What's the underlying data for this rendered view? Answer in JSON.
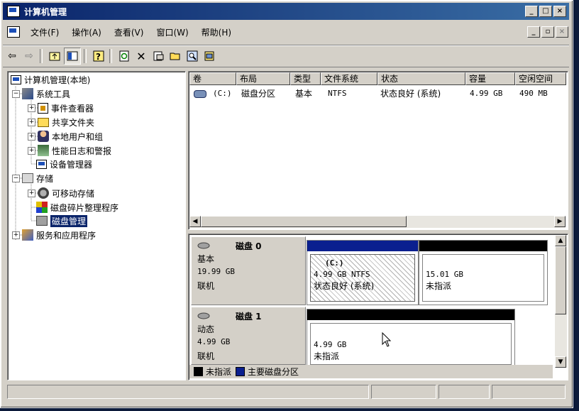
{
  "window": {
    "title": "计算机管理"
  },
  "menu": {
    "items": [
      "文件(F)",
      "操作(A)",
      "查看(V)",
      "窗口(W)",
      "帮助(H)"
    ]
  },
  "tree": {
    "root": "计算机管理(本地)",
    "system_tools": "系统工具",
    "event_viewer": "事件查看器",
    "shared_folders": "共享文件夹",
    "local_users": "本地用户和组",
    "perf_logs": "性能日志和警报",
    "device_manager": "设备管理器",
    "storage": "存储",
    "removable_storage": "可移动存储",
    "defrag": "磁盘碎片整理程序",
    "disk_management": "磁盘管理",
    "services_apps": "服务和应用程序"
  },
  "volume_list": {
    "columns": [
      "卷",
      "布局",
      "类型",
      "文件系统",
      "状态",
      "容量",
      "空闲空间"
    ],
    "rows": [
      {
        "volume": "(C:)",
        "layout": "磁盘分区",
        "type": "基本",
        "fs": "NTFS",
        "status": "状态良好 (系统)",
        "capacity": "4.99 GB",
        "free": "490 MB"
      }
    ]
  },
  "disks": [
    {
      "name": "磁盘 0",
      "type": "基本",
      "size": "19.99 GB",
      "state": "联机",
      "partitions": [
        {
          "label": "(C:)",
          "size": "4.99 GB NTFS",
          "status": "状态良好 (系统)"
        },
        {
          "size": "15.01 GB",
          "status": "未指派"
        }
      ]
    },
    {
      "name": "磁盘 1",
      "type": "动态",
      "size": "4.99 GB",
      "state": "联机",
      "partitions": [
        {
          "size": "4.99 GB",
          "status": "未指派"
        }
      ]
    }
  ],
  "legend": {
    "unallocated": "未指派",
    "primary": "主要磁盘分区"
  },
  "colors": {
    "title_bar": "#0a246a",
    "primary_partition": "#0a1f8f",
    "unallocated": "#000000"
  }
}
